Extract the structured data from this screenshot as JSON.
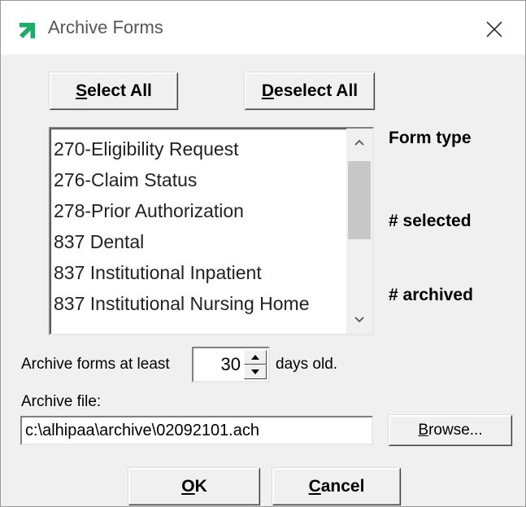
{
  "window": {
    "title": "Archive Forms",
    "accent_color": "#1faa6a"
  },
  "buttons": {
    "select_all": {
      "mnemonic": "S",
      "rest": "elect All"
    },
    "deselect_all": {
      "mnemonic": "D",
      "rest": "eselect All"
    },
    "browse": {
      "mnemonic": "B",
      "rest": "rowse..."
    },
    "ok": {
      "mnemonic": "O",
      "rest": "K"
    },
    "cancel": {
      "mnemonic": "C",
      "rest": "ancel"
    }
  },
  "form_list": {
    "items": [
      "270-Eligibility Request",
      "276-Claim Status",
      "278-Prior Authorization",
      "837 Dental",
      "837 Institutional Inpatient",
      "837 Institutional Nursing Home"
    ]
  },
  "side_labels": {
    "form_type": "Form type",
    "selected": "# selected",
    "archived": "# archived"
  },
  "archive_age": {
    "prefix": "Archive forms at least",
    "value": "30",
    "suffix": "days old."
  },
  "archive_file": {
    "label": "Archive file:",
    "value": "c:\\alhipaa\\archive\\02092101.ach"
  }
}
